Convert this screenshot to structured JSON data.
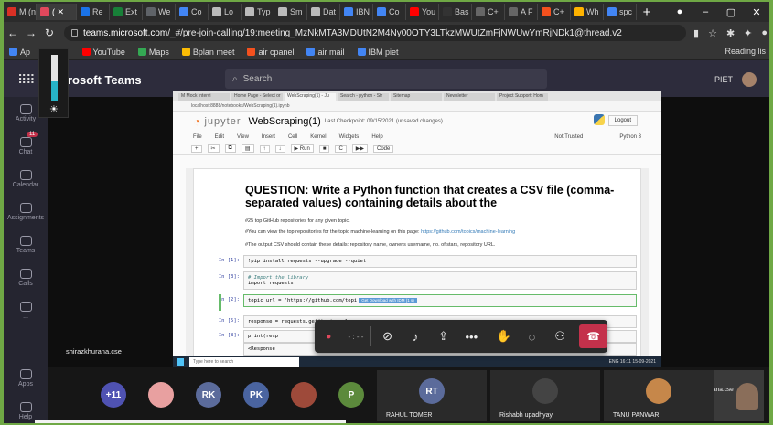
{
  "browser": {
    "tabs": [
      {
        "label": "M (nc",
        "color": "#d93025"
      },
      {
        "label": "( ✕",
        "color": "#e0485c",
        "active": true
      },
      {
        "label": "Re",
        "color": "#1a73e8"
      },
      {
        "label": "Ext",
        "color": "#188038"
      },
      {
        "label": "We",
        "color": "#5f6368"
      },
      {
        "label": "Co",
        "color": "#4285f4"
      },
      {
        "label": "Lo",
        "color": "#bbb"
      },
      {
        "label": "Typ",
        "color": "#bbb"
      },
      {
        "label": "Sm",
        "color": "#bbb"
      },
      {
        "label": "Dat",
        "color": "#bbb"
      },
      {
        "label": "IBN",
        "color": "#4285f4"
      },
      {
        "label": "Co",
        "color": "#4285f4"
      },
      {
        "label": "You",
        "color": "#ff0000"
      },
      {
        "label": "Bas",
        "color": "#333"
      },
      {
        "label": "C+",
        "color": "#666"
      },
      {
        "label": "A F",
        "color": "#666"
      },
      {
        "label": "C+",
        "color": "#f4511e"
      },
      {
        "label": "Wh",
        "color": "#ffb300"
      },
      {
        "label": "spc",
        "color": "#4285f4"
      }
    ],
    "new_tab": "+",
    "url_host": "teams.microsoft.com",
    "url_path": "/_#/pre-join-calling/19:meeting_MzNkMTA3MDUtN2M4Ny00OTY3LTkzMWUtZmFjNWUwYmRjNDk1@thread.v2",
    "bookmarks": [
      {
        "label": "Ap",
        "color": "#4285f4"
      },
      {
        "label": "mail",
        "color": "#d93025"
      },
      {
        "label": "YouTube",
        "color": "#ff0000"
      },
      {
        "label": "Maps",
        "color": "#34a853"
      },
      {
        "label": "Bplan meet",
        "color": "#fbbc04"
      },
      {
        "label": "air cpanel",
        "color": "#f4511e"
      },
      {
        "label": "air mail",
        "color": "#4285f4"
      },
      {
        "label": "IBM piet",
        "color": "#4285f4"
      }
    ],
    "reading_list": "Reading lis"
  },
  "teams": {
    "brand": "rosoft Teams",
    "search_placeholder": "Search",
    "org": "PIET",
    "rail": [
      {
        "label": "Activity"
      },
      {
        "label": "Chat",
        "badge": "11"
      },
      {
        "label": "Calendar"
      },
      {
        "label": "Assignments"
      },
      {
        "label": "Teams"
      },
      {
        "label": "Calls"
      },
      {
        "label": "..."
      },
      {
        "label": "Apps"
      },
      {
        "label": "Help"
      }
    ],
    "brightness_level": 0.42
  },
  "notebook": {
    "inner_tabs": [
      "M Mock Intervi",
      "Home Page - Select or",
      "WebScraping(1) - Ju",
      "Search - python - Str",
      "Sitemap",
      "Newsletter",
      "Project Support: Hom"
    ],
    "inner_url": "localhost:8888/notebooks/WebScraping(1).ipynb",
    "app_name": "jupyter",
    "title": "WebScraping(1)",
    "checkpoint": "Last Checkpoint: 09/15/2021  (unsaved changes)",
    "logout": "Logout",
    "menu": [
      "File",
      "Edit",
      "View",
      "Insert",
      "Cell",
      "Kernel",
      "Widgets",
      "Help"
    ],
    "trust": "Not Trusted",
    "kernel": "Python 3",
    "toolbar": [
      "+",
      "✂",
      "⧉",
      "▤",
      "↑",
      "↓",
      "▶ Run",
      "■",
      "C",
      "▶▶",
      "Code"
    ],
    "question": "QUESTION: Write a Python function that creates a CSV file (comma-separated values) containing details about the",
    "md1": "#25 top GitHub repositories for any given topic.",
    "md2": "#You can view the top repositories for the topic machine-learning on this page:",
    "md2_link": "https://github.com/topics/machine-learning",
    "md3": "#The output CSV should contain these details: repository name, owner's username, no. of stars, repository URL.",
    "cells": [
      {
        "prompt": "In [1]:",
        "code": "!pip install requests --upgrade --quiet"
      },
      {
        "prompt": "In [3]:",
        "comment": "# Import the library",
        "code": "import requests"
      },
      {
        "prompt": "In [2]:",
        "code": "topic_url = 'https://github.com/topi",
        "chip": "Get Download with IDM (1 s)"
      },
      {
        "prompt": "In [5]:",
        "code": "response = requests.get(topic_url)"
      },
      {
        "prompt": "In [8]:",
        "code": "print(resp"
      },
      {
        "prompt": "",
        "code": "<Response"
      }
    ],
    "task_search": "Type here to search",
    "task_tray": "ENG  16:11  15-09-2021"
  },
  "call": {
    "shared_by": "shirazkhurana.cse",
    "controls": [
      "record",
      "timer",
      "camera",
      "mic",
      "share",
      "more",
      "raise-hand",
      "chat",
      "people",
      "leave"
    ],
    "timer": "- : - -"
  },
  "participants": {
    "overflow": "+11",
    "avatars": [
      {
        "initials": "",
        "color": "#e8a0a0"
      },
      {
        "initials": "RK",
        "color": "#5b6b9b"
      },
      {
        "initials": "PK",
        "color": "#4a64a0"
      },
      {
        "initials": "",
        "color": "#9e4a3a"
      },
      {
        "initials": "P",
        "color": "#5c8a3c"
      }
    ],
    "tiles": [
      {
        "name": "RAHUL TOMER",
        "initials": "RT",
        "color": "#5b6b9b"
      },
      {
        "name": "Rishabh upadhyay",
        "initials": "",
        "color": "#444"
      },
      {
        "name": "TANU PANWAR",
        "initials": "",
        "color": "#c6874a"
      }
    ],
    "self_name": "shirazkhurana.cse"
  }
}
